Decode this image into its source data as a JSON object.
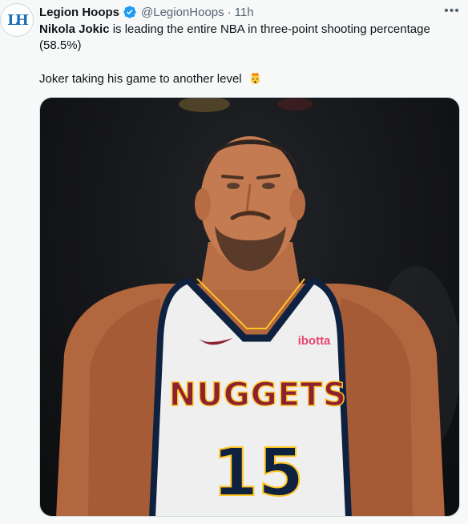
{
  "tweet": {
    "display_name": "Legion Hoops",
    "handle": "@LegionHoops",
    "separator": "·",
    "time": "11h",
    "text_bold": "Nikola Jokic",
    "text_rest": " is leading the entire NBA in three-point shooting percentage (58.5%)",
    "line2": "Joker taking his game to another level",
    "emoji": "exploding-head-emoji",
    "verified_color": "#1d9bf0"
  },
  "image": {
    "sponsor": "ibotta",
    "team": "NUGGETS",
    "number": "15"
  }
}
